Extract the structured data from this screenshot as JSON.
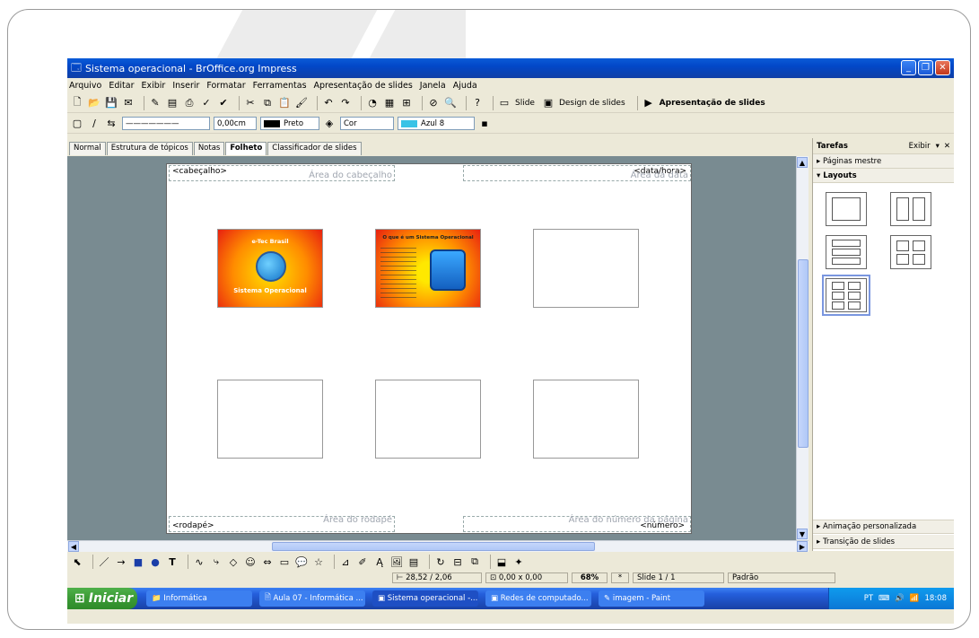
{
  "window": {
    "title": "Sistema operacional - BrOffice.org Impress"
  },
  "menu": [
    "Arquivo",
    "Editar",
    "Exibir",
    "Inserir",
    "Formatar",
    "Ferramentas",
    "Apresentação de slides",
    "Janela",
    "Ajuda"
  ],
  "toolbar1": {
    "slide_label": "Slide",
    "design_label": "Design de slides",
    "presentation_label": "Apresentação de slides"
  },
  "toolbar2": {
    "line_width": "0,00cm",
    "line_color": "Preto",
    "fill_mode": "Cor",
    "fill_color": "Azul 8"
  },
  "view_tabs": [
    {
      "label": "Normal"
    },
    {
      "label": "Estrutura de tópicos"
    },
    {
      "label": "Notas"
    },
    {
      "label": "Folheto",
      "active": true
    },
    {
      "label": "Classificador de slides"
    }
  ],
  "handout": {
    "header_label": "<cabeçalho>",
    "header_area": "Área do cabeçalho",
    "date_label": "<data/hora>",
    "date_area": "Área da data",
    "footer_label": "<rodapé>",
    "footer_area": "Área do rodapé",
    "number_label": "<número>",
    "number_area": "Área do número da página",
    "slide1": {
      "title": "e-Tec Brasil",
      "subtitle": "Sistema Operacional"
    },
    "slide2": {
      "title": "O que é um Sistema Operacional"
    }
  },
  "tasks_panel": {
    "title": "Tarefas",
    "view_label": "Exibir",
    "sections": {
      "master": "Páginas mestre",
      "layouts": "Layouts",
      "animation": "Animação personalizada",
      "transition": "Transição de slides"
    }
  },
  "status": {
    "position": "28,52 / 2,06",
    "size": "0,00 x 0,00",
    "zoom": "68%",
    "modified": "*",
    "slide": "Slide 1 / 1",
    "master": "Padrão"
  },
  "taskbar": {
    "start_label": "Iniciar",
    "tasks": [
      "Informática",
      "Aula 07 - Informática ...",
      "Sistema operacional -...",
      "Redes de computado...",
      "imagem - Paint"
    ],
    "tray_lang": "PT",
    "clock": "18:08"
  }
}
